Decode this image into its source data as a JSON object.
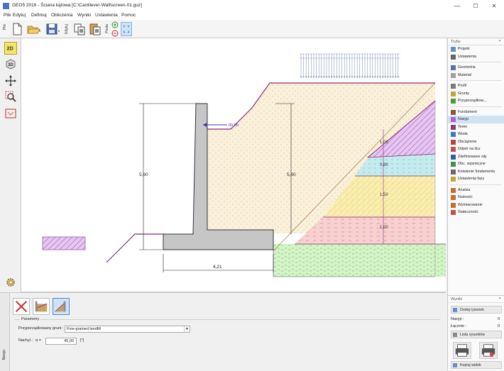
{
  "window": {
    "title": "GEO5 2016 - Ściana kątowa [C:\\Cantilever-Wall\\screen-01.guz]",
    "minimize": "—",
    "maximize": "☐",
    "close": "✕"
  },
  "menu": [
    "Plik",
    "Edytuj",
    "Definiuj",
    "Obliczenia",
    "Wyniki",
    "Ustawienia",
    "Pomoc"
  ],
  "toolbar": {
    "group1_label": "Plik",
    "group2_label": "Edytuj",
    "group3_label": "Pasta"
  },
  "canvas": {
    "dim_height_left": "5,60",
    "dim_height_right": "5,60",
    "dim_width": "4,21",
    "load_value": "00,00",
    "layer_labels": [
      "1,00",
      "0,80",
      "1,50",
      "1,00"
    ]
  },
  "right_panel": {
    "header": "Tryby",
    "pin": "▪",
    "groups": [
      [
        {
          "label": "Projekt",
          "icon": "project-icon",
          "color": "#6a8fc4"
        },
        {
          "label": "Ustawienia",
          "icon": "settings-icon",
          "color": "#666666"
        }
      ],
      [
        {
          "label": "Geometria",
          "icon": "geometry-icon",
          "color": "#5b6fa8"
        },
        {
          "label": "Materiał",
          "icon": "material-icon",
          "color": "#a0a0a0"
        }
      ],
      [
        {
          "label": "Profil",
          "icon": "profile-icon",
          "color": "#7a7a7a"
        },
        {
          "label": "Grunty",
          "icon": "soils-icon",
          "color": "#c9a13a"
        },
        {
          "label": "Przyporządkow...",
          "icon": "assign-icon",
          "color": "#4e9a3a"
        }
      ],
      [
        {
          "label": "Fundament",
          "icon": "foundation-icon",
          "color": "#8a5a2a"
        },
        {
          "label": "Nasyp",
          "icon": "backfill-icon",
          "color": "#b060c0"
        },
        {
          "label": "Teren",
          "icon": "terrain-icon",
          "color": "#8a3a7a"
        },
        {
          "label": "Woda",
          "icon": "water-icon",
          "color": "#3a7ac9"
        },
        {
          "label": "Obciążenie",
          "icon": "load-icon",
          "color": "#c04040"
        },
        {
          "label": "Odpór na licu",
          "icon": "face-resistance-icon",
          "color": "#c05050"
        },
        {
          "label": "Zdefiniowane siły",
          "icon": "forces-icon",
          "color": "#3060a0"
        },
        {
          "label": "Obc. sejsmiczne",
          "icon": "seismic-icon",
          "color": "#4a8a4a"
        },
        {
          "label": "Kotwienie fundamentu",
          "icon": "anchor-icon",
          "color": "#6a6a6a"
        },
        {
          "label": "Ustawienia fazy",
          "icon": "stage-settings-icon",
          "color": "#c9a13a"
        }
      ],
      [
        {
          "label": "Analiza",
          "icon": "analysis-icon",
          "color": "#c07030"
        },
        {
          "label": "Nośność",
          "icon": "bearing-icon",
          "color": "#c07030"
        },
        {
          "label": "Wymiarowanie",
          "icon": "dimensioning-icon",
          "color": "#c07030"
        },
        {
          "label": "Stateczność",
          "icon": "stability-icon",
          "color": "#c05050"
        }
      ]
    ]
  },
  "bottom": {
    "strip_label": "Nasyp",
    "group_title": "Parametry",
    "assigned_soil_label": "Przyporządkowany grunt :",
    "assigned_soil_value": "Fine-grained landfill",
    "slope_label": "Nachyl. :",
    "alpha_label": "α =",
    "slope_value": "45,00",
    "slope_unit": "[°]"
  },
  "results_panel": {
    "header": "Wyniki",
    "add_drawing": "Dodaj rysunek",
    "backfill_label": "Nasyp :",
    "backfill_value": "0",
    "total_label": "Łącznie :",
    "total_value": "0",
    "drawing_list": "Lista rysunków",
    "copy_view": "Kopiuj widok"
  }
}
